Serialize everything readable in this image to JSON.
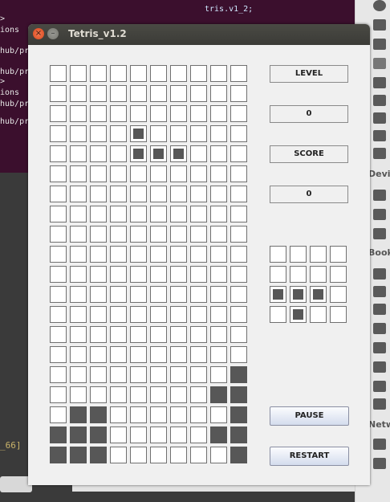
{
  "terminal": {
    "top_text": "tris.v1_2;",
    "lines": [
      ">",
      "ions",
      "hub/pr",
      "hub/pr",
      "",
      ">",
      "ions",
      "hub/pr",
      "",
      "hub/pr"
    ],
    "bottom_text": "_66]"
  },
  "sidebar": {
    "labels": [
      "Devic",
      "Book",
      "Netw"
    ]
  },
  "window": {
    "title": "Tetris_v1.2",
    "close_glyph": "×",
    "min_glyph": "–"
  },
  "panel": {
    "level_label": "LEVEL",
    "level_value": "0",
    "score_label": "SCORE",
    "score_value": "0",
    "pause_button": "PAUSE",
    "restart_button": "RESTART"
  },
  "board": {
    "cols": 10,
    "rows": 20,
    "active_piece": [
      [
        4,
        3
      ],
      [
        4,
        4
      ],
      [
        5,
        4
      ],
      [
        6,
        4
      ]
    ],
    "filled": [
      [
        9,
        15
      ],
      [
        9,
        16
      ],
      [
        8,
        16
      ],
      [
        1,
        17
      ],
      [
        2,
        17
      ],
      [
        9,
        17
      ],
      [
        0,
        18
      ],
      [
        1,
        18
      ],
      [
        2,
        18
      ],
      [
        8,
        18
      ],
      [
        9,
        18
      ],
      [
        0,
        19
      ],
      [
        1,
        19
      ],
      [
        2,
        19
      ],
      [
        9,
        19
      ]
    ]
  },
  "next_piece": {
    "cols": 4,
    "rows": 4,
    "filled": [
      [
        0,
        2
      ],
      [
        1,
        2
      ],
      [
        2,
        2
      ],
      [
        1,
        3
      ]
    ]
  }
}
